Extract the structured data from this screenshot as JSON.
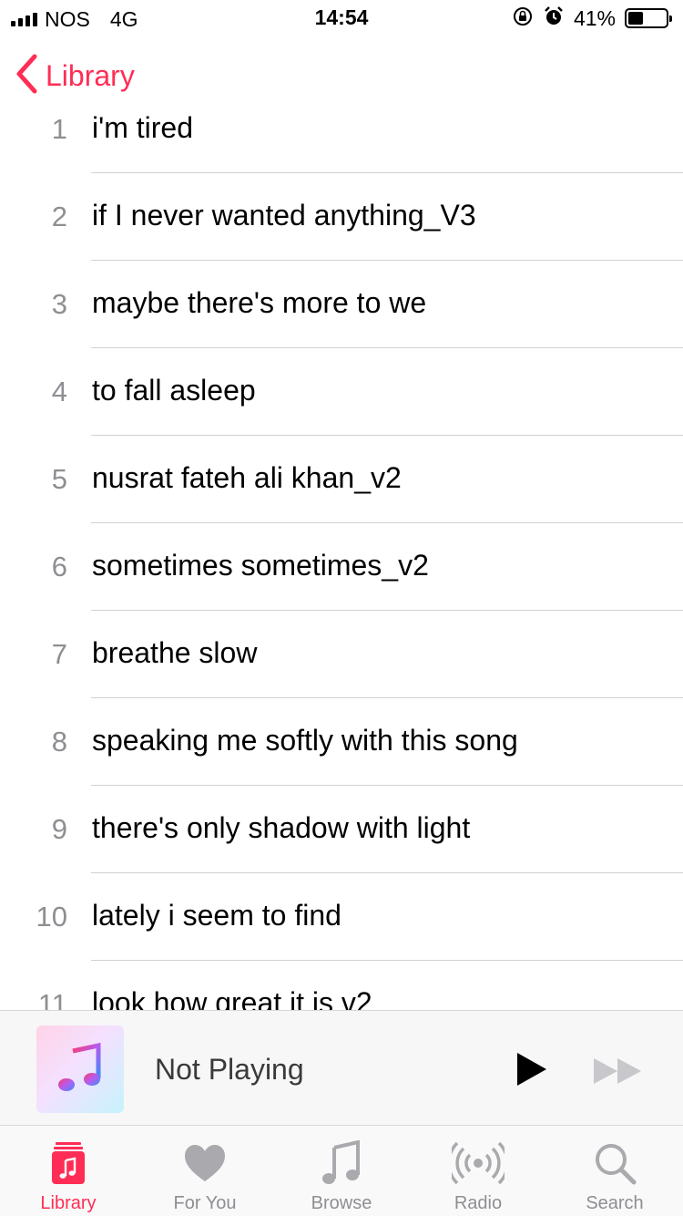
{
  "status_bar": {
    "carrier": "NOS",
    "network": "4G",
    "time": "14:54",
    "battery": "41%",
    "battery_level": 0.41
  },
  "nav": {
    "back_label": "Library"
  },
  "tracks": [
    {
      "number": "1",
      "title": "i'm tired"
    },
    {
      "number": "2",
      "title": "if I never wanted anything_V3"
    },
    {
      "number": "3",
      "title": "maybe there's more to we"
    },
    {
      "number": "4",
      "title": "to fall asleep"
    },
    {
      "number": "5",
      "title": "nusrat fateh ali khan_v2"
    },
    {
      "number": "6",
      "title": "sometimes sometimes_v2"
    },
    {
      "number": "7",
      "title": "breathe slow"
    },
    {
      "number": "8",
      "title": "speaking me softly with this song"
    },
    {
      "number": "9",
      "title": "there's only shadow with light"
    },
    {
      "number": "10",
      "title": "lately i seem to find"
    },
    {
      "number": "11",
      "title": "look how great it is v2"
    }
  ],
  "mini_player": {
    "status": "Not Playing",
    "artwork_icon": "music-note-icon",
    "play_icon": "play-icon",
    "forward_icon": "fast-forward-icon"
  },
  "tab_bar": {
    "items": [
      {
        "label": "Library",
        "icon": "library-icon",
        "active": true
      },
      {
        "label": "For You",
        "icon": "heart-icon",
        "active": false
      },
      {
        "label": "Browse",
        "icon": "music-note-icon",
        "active": false
      },
      {
        "label": "Radio",
        "icon": "radio-icon",
        "active": false
      },
      {
        "label": "Search",
        "icon": "search-icon",
        "active": false
      }
    ]
  },
  "colors": {
    "accent": "#ff2d55",
    "secondary_text": "#8e8e93",
    "separator": "#d1d1d6"
  }
}
